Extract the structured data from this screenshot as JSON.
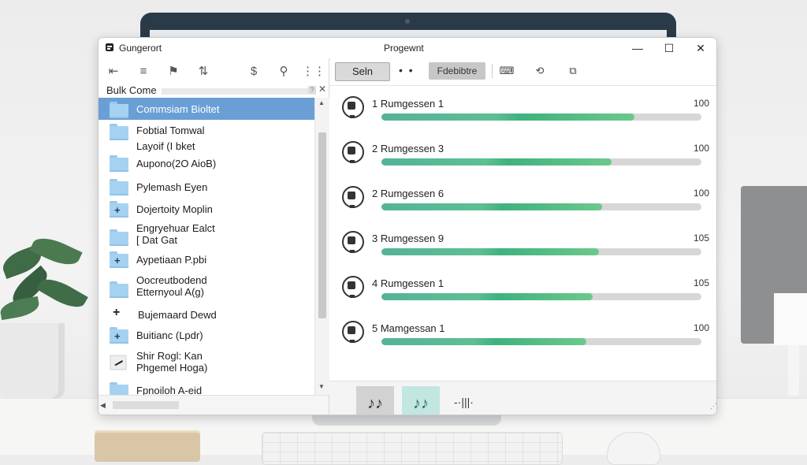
{
  "window": {
    "app_name": "Gungerort",
    "title": "Progewnt",
    "controls": {
      "minimize": "—",
      "maximize": "☐",
      "close": "✕"
    }
  },
  "left_toolbar": {
    "icons": [
      "back-stack-icon",
      "layers-icon",
      "flag-icon",
      "sort-icon",
      "dollar-icon",
      "search-icon",
      "grid-icon"
    ],
    "glyphs": [
      "⇤",
      "≡",
      "⚑",
      "⇅",
      "$",
      "⚲",
      "⋮⋮"
    ]
  },
  "bulk": {
    "label": "Bulk Come",
    "help": "?",
    "close": "✕"
  },
  "sidebar": {
    "items": [
      {
        "label": "Commsiam Bioltet",
        "icon": "folder",
        "selected": true
      },
      {
        "label": "Fobtial Tomwal",
        "icon": "folder",
        "selected": false
      },
      {
        "label": "Layoif (I bket",
        "icon": "folder",
        "selected": false
      },
      {
        "label": "Aupono(2O AioB)",
        "icon": "folder",
        "selected": false
      },
      {
        "label": "Pylemash Eyen",
        "icon": "folder",
        "selected": false
      },
      {
        "label": "Dojertoity Moplin",
        "icon": "folder-plus",
        "selected": false
      },
      {
        "label": "Engryehuar Ealct",
        "label2": "[ Dat Gat",
        "icon": "folder",
        "selected": false
      },
      {
        "label": "Aypetiaan P.pbi",
        "icon": "folder-plus",
        "selected": false
      },
      {
        "label": "Oocreutbodend",
        "label2": "Etternyoul A(g)",
        "icon": "folder",
        "selected": false
      },
      {
        "label": "Bujemaard Dewd",
        "icon": "plus",
        "selected": false
      },
      {
        "label": "Buitianc (Lpdr)",
        "icon": "folder-plus",
        "selected": false
      },
      {
        "label": "Shir Rogl: Kan",
        "label2": "Phgemel Hoga)",
        "icon": "pen",
        "selected": false
      },
      {
        "label": "Fpnoiloh A-eid",
        "icon": "folder",
        "selected": false
      }
    ]
  },
  "right_toolbar": {
    "seln_label": "Seln",
    "dots": "• •",
    "feat_label": "Fdebibtre",
    "icons": [
      "keyboard-icon",
      "loop-icon",
      "export-icon"
    ],
    "glyphs": [
      "⌨",
      "⟲",
      "⧉"
    ]
  },
  "tracks": [
    {
      "label": "1 Rumgessen 1",
      "value": "100",
      "progress": 0.79
    },
    {
      "label": "2 Rumgessen 3",
      "value": "100",
      "progress": 0.72
    },
    {
      "label": "2 Rumgessen 6",
      "value": "100",
      "progress": 0.69
    },
    {
      "label": "3 Rumgessen 9",
      "value": "105",
      "progress": 0.68
    },
    {
      "label": "4 Rumgessen 1",
      "value": "105",
      "progress": 0.66
    },
    {
      "label": "5 Mamgessan 1",
      "value": "100",
      "progress": 0.64
    }
  ],
  "bottom": {
    "note_gray": "♪♪",
    "note_teal": "♪♪",
    "waveform": "-·|||·"
  },
  "colors": {
    "selection": "#6a9fd6",
    "progress_green": "#5dbf93",
    "track_bg": "#d7d7d7"
  }
}
